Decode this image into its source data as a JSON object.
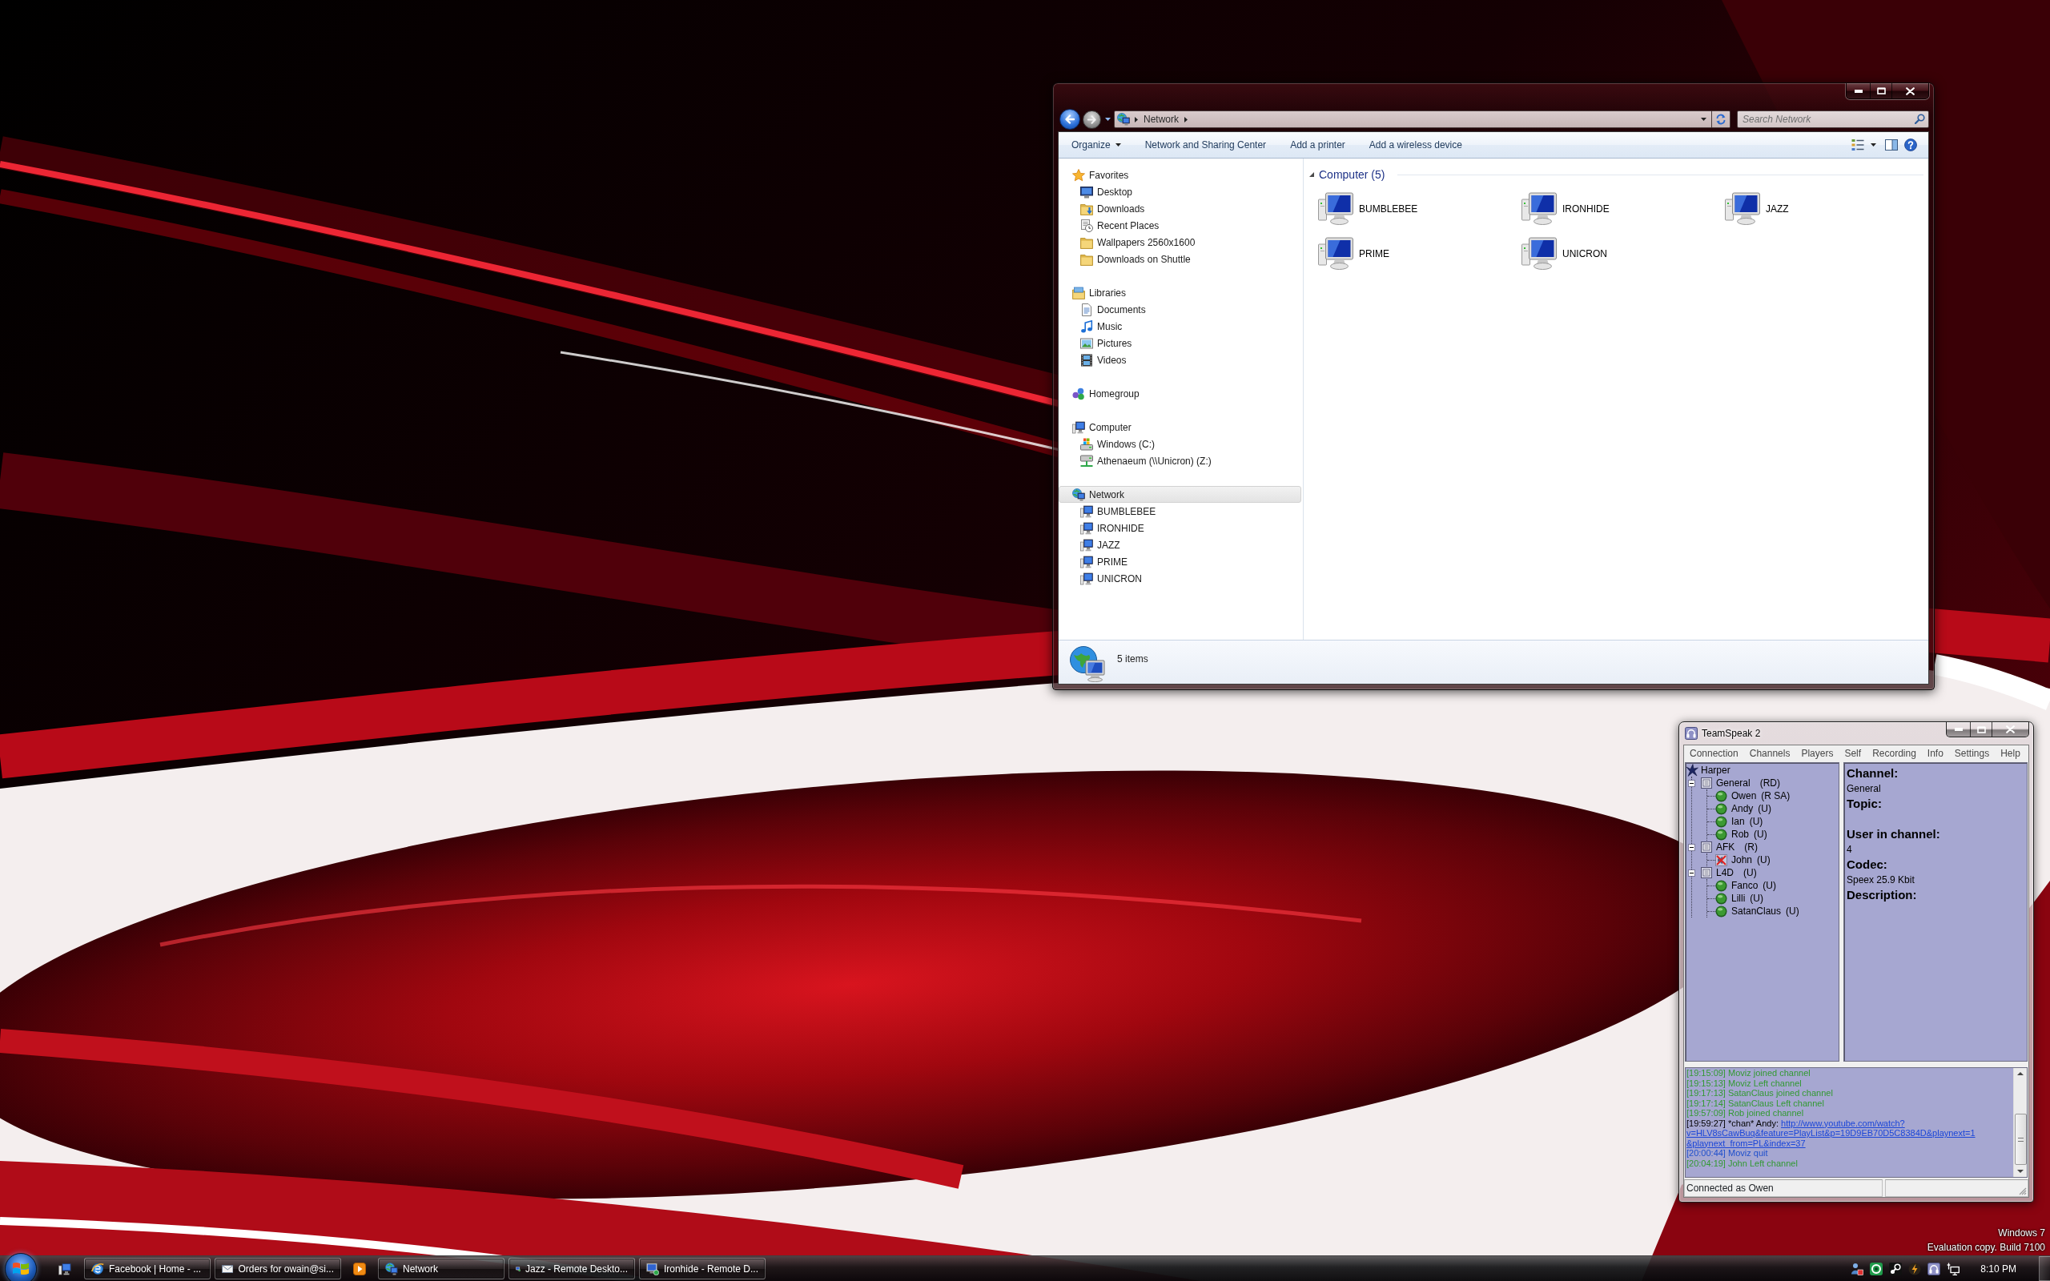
{
  "explorer": {
    "address": {
      "crumbs": [
        "Network"
      ]
    },
    "search": {
      "placeholder": "Search Network"
    },
    "toolbar": [
      {
        "label": "Organize",
        "dropdown": true
      },
      {
        "label": "Network and Sharing Center",
        "dropdown": false
      },
      {
        "label": "Add a printer",
        "dropdown": false
      },
      {
        "label": "Add a wireless device",
        "dropdown": false
      }
    ],
    "nav": [
      {
        "label": "Favorites",
        "selected": false,
        "children": [
          {
            "label": "Desktop",
            "selected": false
          },
          {
            "label": "Downloads",
            "selected": false
          },
          {
            "label": "Recent Places",
            "selected": false
          },
          {
            "label": "Wallpapers 2560x1600",
            "selected": false
          },
          {
            "label": "Downloads on Shuttle",
            "selected": false
          }
        ]
      },
      {
        "label": "Libraries",
        "selected": false,
        "children": [
          {
            "label": "Documents",
            "selected": false
          },
          {
            "label": "Music",
            "selected": false
          },
          {
            "label": "Pictures",
            "selected": false
          },
          {
            "label": "Videos",
            "selected": false
          }
        ]
      },
      {
        "label": "Homegroup",
        "selected": false
      },
      {
        "label": "Computer",
        "selected": false,
        "children": [
          {
            "label": "Windows (C:)",
            "selected": false
          },
          {
            "label": "Athenaeum (\\\\Unicron) (Z:)",
            "selected": false
          }
        ]
      },
      {
        "label": "Network",
        "selected": true,
        "children": [
          {
            "label": "BUMBLEBEE",
            "selected": false
          },
          {
            "label": "IRONHIDE",
            "selected": false
          },
          {
            "label": "JAZZ",
            "selected": false
          },
          {
            "label": "PRIME",
            "selected": false
          },
          {
            "label": "UNICRON",
            "selected": false
          }
        ]
      }
    ],
    "group": {
      "title": "Computer (5)",
      "expanded": true,
      "items": [
        {
          "label": "BUMBLEBEE",
          "selected": false
        },
        {
          "label": "IRONHIDE",
          "selected": false
        },
        {
          "label": "JAZZ",
          "selected": false
        },
        {
          "label": "PRIME",
          "selected": false
        },
        {
          "label": "UNICRON",
          "selected": false
        }
      ]
    },
    "status": "5 items"
  },
  "teamspeak": {
    "title": "TeamSpeak 2",
    "menu": [
      "Connection",
      "Channels",
      "Players",
      "Self",
      "Recording",
      "Info",
      "Settings",
      "Help"
    ],
    "server": {
      "name": "Harper",
      "children": [
        {
          "name": "General",
          "flags": "(RD)",
          "expanded": true,
          "children": [
            {
              "name": "Owen",
              "flags": "(R SA)",
              "muted": false
            },
            {
              "name": "Andy",
              "flags": "(U)",
              "muted": false
            },
            {
              "name": "Ian",
              "flags": "(U)",
              "muted": false
            },
            {
              "name": "Rob",
              "flags": "(U)",
              "muted": false
            }
          ]
        },
        {
          "name": "AFK",
          "flags": "(R)",
          "expanded": true,
          "children": [
            {
              "name": "John",
              "flags": "(U)",
              "muted": true
            }
          ]
        },
        {
          "name": "L4D",
          "flags": "(U)",
          "expanded": true,
          "children": [
            {
              "name": "Fanco",
              "flags": "(U)",
              "muted": false
            },
            {
              "name": "Lilli",
              "flags": "(U)",
              "muted": false
            },
            {
              "name": "SatanClaus",
              "flags": "(U)",
              "muted": false
            }
          ]
        }
      ]
    },
    "info": [
      {
        "label": "Channel:",
        "value": "General"
      },
      {
        "label": "Topic:"
      },
      {
        "label": "User in channel:",
        "value": "4"
      },
      {
        "label": "Codec:",
        "value": "Speex 25.9 Kbit"
      },
      {
        "label": "Description:"
      }
    ],
    "log": [
      {
        "kind": "event",
        "text": "[19:15:09] Moviz joined channel",
        "color": "#339933"
      },
      {
        "kind": "event",
        "text": "[19:15:13] Moviz Left channel",
        "color": "#339933"
      },
      {
        "kind": "event",
        "text": "[19:17:13] SatanClaus joined channel",
        "color": "#339933"
      },
      {
        "kind": "event",
        "text": "[19:17:14] SatanClaus Left channel",
        "color": "#339933"
      },
      {
        "kind": "event",
        "text": "[19:57:09] Rob joined channel",
        "color": "#339933"
      },
      {
        "kind": "chat",
        "text": "[19:59:27] *chan* Andy:",
        "link_lines": [
          "http://www.youtube.com/watch?",
          "v=HLV8sCawBuq&feature=PlayList&p=19D9EB70D5C8384D&playnext=1",
          "&playnext_from=PL&index=37"
        ]
      },
      {
        "kind": "event",
        "text": "[20:00:44] Moviz quit",
        "color": "#1f4fcc"
      },
      {
        "kind": "event",
        "text": "[20:04:19] John Left channel",
        "color": "#339933"
      }
    ],
    "status": "Connected as Owen"
  },
  "desktop": {
    "notice": [
      "Windows 7",
      "Evaluation copy. Build 7100"
    ]
  },
  "taskbar": {
    "items": [
      {
        "kind": "window",
        "label": "Facebook | Home - ..."
      },
      {
        "kind": "window",
        "label": "Orders for owain@si..."
      },
      {
        "kind": "pinned"
      },
      {
        "kind": "window",
        "label": "Network"
      },
      {
        "kind": "window",
        "label": "Jazz - Remote Deskto..."
      },
      {
        "kind": "window",
        "label": "Ironhide - Remote D..."
      }
    ],
    "clock": "8:10 PM"
  }
}
